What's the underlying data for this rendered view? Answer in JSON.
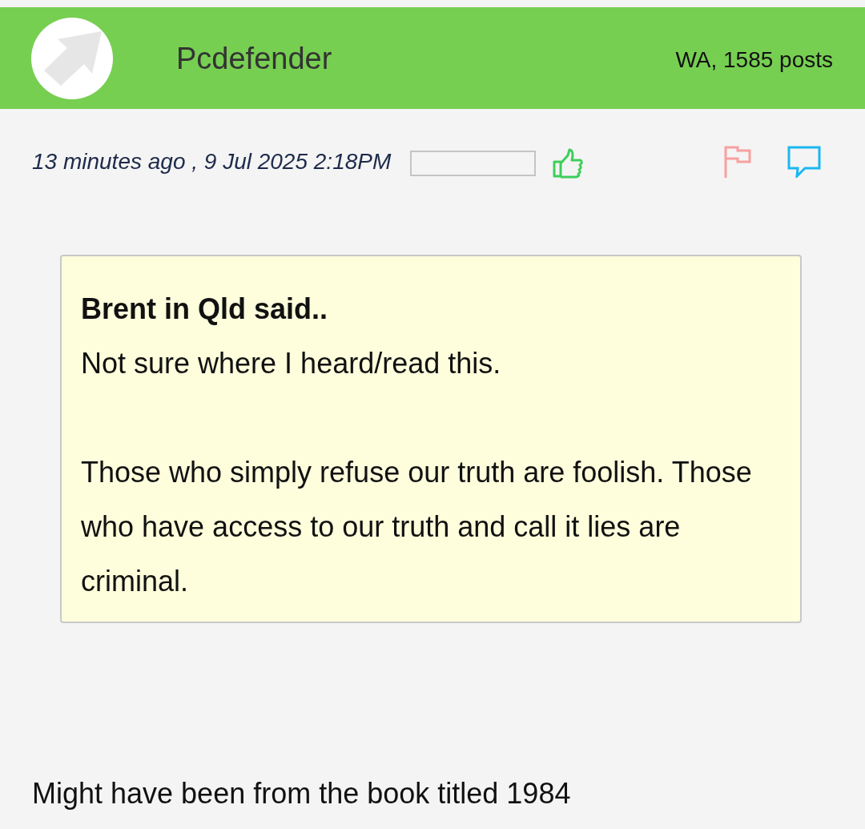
{
  "header": {
    "username": "Pcdefender",
    "meta": "WA, 1585 posts"
  },
  "post": {
    "timestamp": "13 minutes ago , 9 Jul 2025 2:18PM",
    "quote": {
      "author": "Brent in Qld said..",
      "paragraphs": [
        "Not sure where I heard/read this.",
        "Those who simply refuse our truth are foolish. Those who have access to our truth and call it lies are criminal."
      ]
    },
    "body": "Might have been from the book titled 1984"
  }
}
